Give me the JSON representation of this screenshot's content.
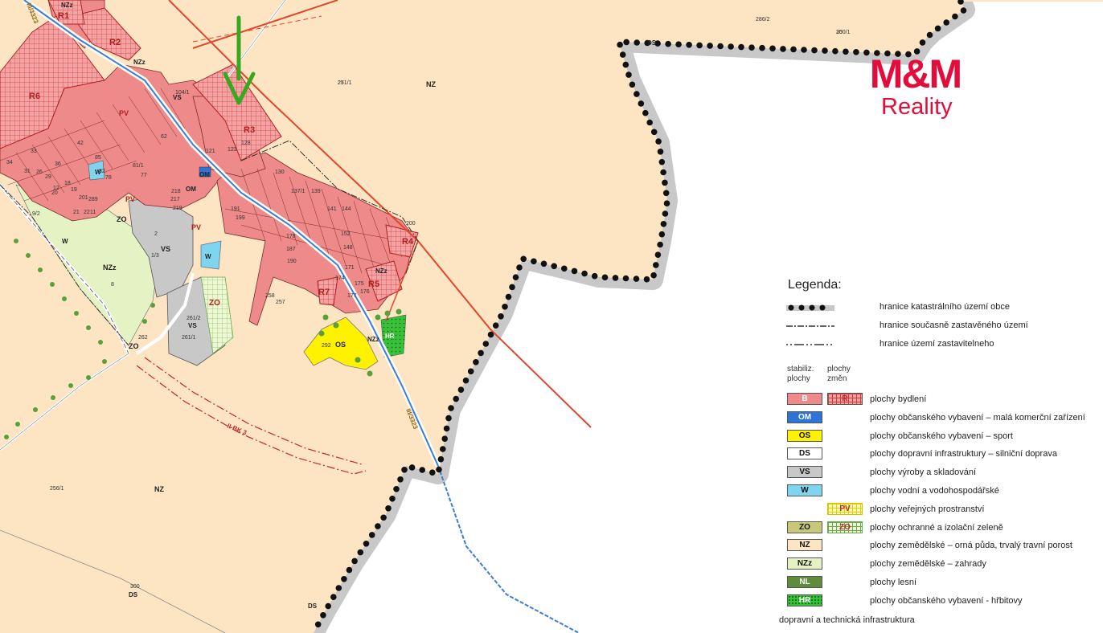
{
  "logo": {
    "brand": "M&M",
    "sub": "Reality"
  },
  "map": {
    "zones": {
      "r1": "R1",
      "r2": "R2",
      "r3": "R3",
      "r4": "R4",
      "r5": "R5",
      "r6": "R6",
      "r7": "R7",
      "nz_main": "NZ",
      "nz_bottom": "NZ",
      "nzz_main": "NZz",
      "nzz_top": "NZz",
      "nzz_right": "NZz",
      "nzz_r5": "NZz",
      "nzz_hr": "NZz",
      "vs1": "VS",
      "vs2": "VS",
      "vs3": "VS",
      "os": "OS",
      "hr": "HR",
      "zo1": "ZO",
      "zo2": "ZO",
      "zo3": "ZO",
      "pv1": "PV",
      "pv2": "PV",
      "pv3": "PV",
      "om1": "OM",
      "om2": "OM",
      "w1": "W",
      "w2": "W",
      "w3": "W",
      "ds_top": "DS",
      "ds_bottom": "DS",
      "ds_low": "DS"
    },
    "road_labels": {
      "road1": "III/3323",
      "road2": "III/3323",
      "corridor": "II-BK 3"
    },
    "parcels": [
      "251/1",
      "250/1",
      "286/2",
      "256/1",
      "300",
      "292",
      "262",
      "261/1",
      "261/2",
      "258",
      "257",
      "130",
      "128",
      "123",
      "9/2",
      "8",
      "2",
      "1/3",
      "218",
      "217",
      "219",
      "121",
      "34",
      "31",
      "33",
      "36",
      "29",
      "42",
      "85",
      "82",
      "78",
      "81/1",
      "77",
      "62",
      "104/1",
      "137/1",
      "139",
      "141",
      "144",
      "152",
      "148",
      "171",
      "174",
      "175",
      "176",
      "177",
      "178",
      "187",
      "190",
      "191",
      "199",
      "200",
      "201",
      "289",
      "21",
      "22",
      "11",
      "12",
      "18",
      "19",
      "20",
      "26",
      "27",
      "30"
    ]
  },
  "legend": {
    "title": "Legenda:",
    "lines": [
      {
        "label": "hranice katastrálního území obce"
      },
      {
        "label": "hranice současně zastavěného území"
      },
      {
        "label": "hranice území zastavitelneho"
      }
    ],
    "col_stable": "stabiliz. plochy",
    "col_change": "plochy změn",
    "items": [
      {
        "code": "B",
        "change": "R",
        "label": "plochy bydlení",
        "color": "#ef8a8a"
      },
      {
        "code": "OM",
        "change": "",
        "label": "plochy občanského vybavení – malá komerční zařízení",
        "color": "#2d74d6"
      },
      {
        "code": "OS",
        "change": "",
        "label": "plochy občanského vybavení – sport",
        "color": "#fff200"
      },
      {
        "code": "DS",
        "change": "",
        "label": "plochy dopravní infrastruktury – silniční doprava",
        "color": "#ffffff"
      },
      {
        "code": "VS",
        "change": "",
        "label": "plochy výroby a skladování",
        "color": "#c8c8c8"
      },
      {
        "code": "W",
        "change": "",
        "label": "plochy vodní a vodohospodářské",
        "color": "#7fd4f0"
      },
      {
        "code": "",
        "change": "PV",
        "label": "plochy veřejných prostranství",
        "color": "#fffbc0"
      },
      {
        "code": "ZO",
        "change": "ZO",
        "label": "plochy ochranné a izolační zeleně",
        "color": "#c9c878"
      },
      {
        "code": "NZ",
        "change": "",
        "label": "plochy zemědělské – orná půda, trvalý travní porost",
        "color": "#fde5c4"
      },
      {
        "code": "NZz",
        "change": "",
        "label": "plochy zemědělské – zahrady",
        "color": "#e4f2c4"
      },
      {
        "code": "NL",
        "change": "",
        "label": "plochy lesní",
        "color": "#5e8b3c"
      },
      {
        "code": "HR",
        "change": "",
        "label": "plochy občanského vybavení - hřbitovy",
        "color": "#38c038"
      }
    ],
    "footer": "dopravní a technická infrastruktura"
  },
  "colors": {
    "nz": "#fde5c4",
    "b": "#ef8a8a",
    "outline": "#e8e8e8",
    "red_line": "#e2462a",
    "road_blue": "#3a7dd8",
    "arrow": "#3aa81e",
    "accent": "#e30d3b"
  }
}
